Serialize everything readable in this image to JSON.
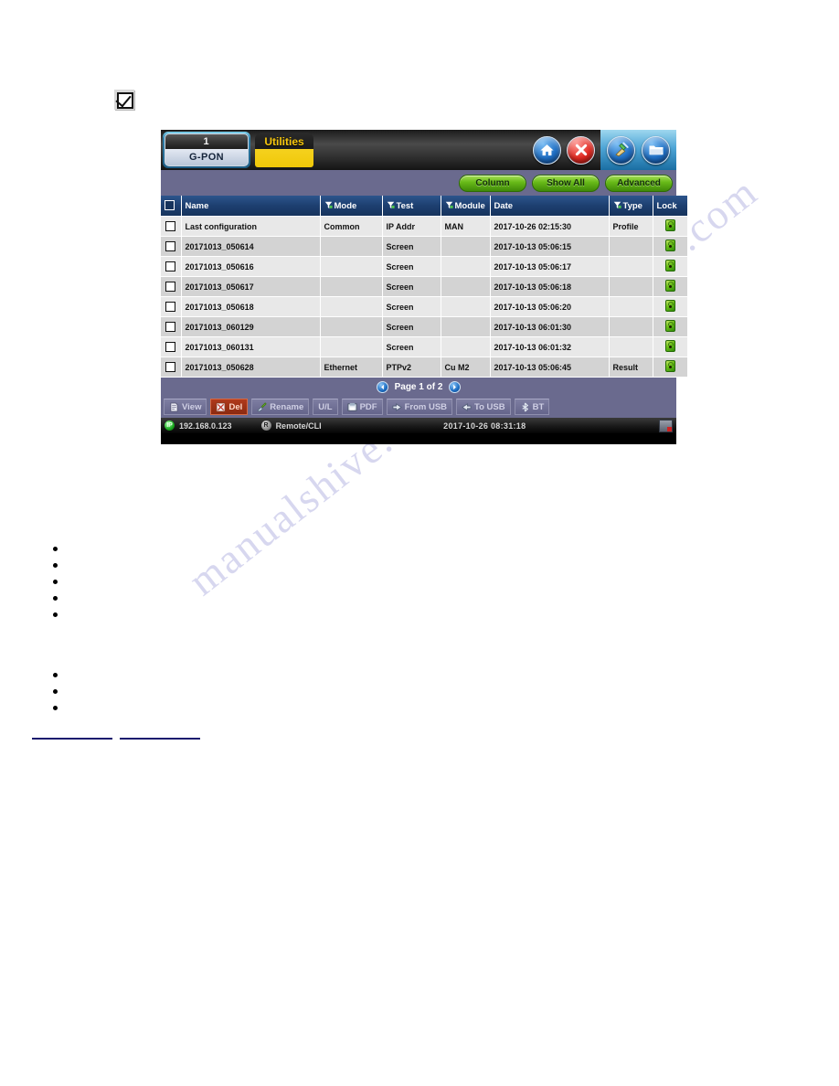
{
  "document": {
    "checkbox_icon": "checked-checkbox-icon",
    "bullets_group_1_count": 5,
    "bullets_group_2_count": 3,
    "watermark_text_1": "manualshive.com",
    "watermark_text_2": "manualshive.com"
  },
  "device": {
    "titlebar": {
      "port_tab": {
        "number": "1",
        "name": "G-PON"
      },
      "active_tab_label": "Utilities",
      "icons": [
        {
          "name": "home-icon",
          "label": "Home"
        },
        {
          "name": "close-icon",
          "label": "Close"
        },
        {
          "name": "tools-icon",
          "label": "Tools"
        },
        {
          "name": "folder-icon",
          "label": "File Browser"
        }
      ]
    },
    "actionbar": {
      "buttons": [
        {
          "label": "Column"
        },
        {
          "label": "Show All"
        },
        {
          "label": "Advanced"
        }
      ]
    },
    "table": {
      "columns": [
        {
          "key": "select",
          "label": "",
          "filter": false
        },
        {
          "key": "name",
          "label": "Name",
          "filter": false
        },
        {
          "key": "mode",
          "label": "Mode",
          "filter": true
        },
        {
          "key": "test",
          "label": "Test",
          "filter": true
        },
        {
          "key": "module",
          "label": "Module",
          "filter": true
        },
        {
          "key": "date",
          "label": "Date",
          "filter": false
        },
        {
          "key": "type",
          "label": "Type",
          "filter": true
        },
        {
          "key": "lock",
          "label": "Lock",
          "filter": false
        }
      ],
      "rows": [
        {
          "name": "Last configuration",
          "mode": "Common",
          "test": "IP Addr",
          "module": "MAN",
          "date": "2017-10-26 02:15:30",
          "type": "Profile",
          "locked": true,
          "checked": false
        },
        {
          "name": "20171013_050614",
          "mode": "",
          "test": "Screen",
          "module": "",
          "date": "2017-10-13 05:06:15",
          "type": "",
          "locked": true,
          "checked": false
        },
        {
          "name": "20171013_050616",
          "mode": "",
          "test": "Screen",
          "module": "",
          "date": "2017-10-13 05:06:17",
          "type": "",
          "locked": true,
          "checked": false
        },
        {
          "name": "20171013_050617",
          "mode": "",
          "test": "Screen",
          "module": "",
          "date": "2017-10-13 05:06:18",
          "type": "",
          "locked": true,
          "checked": false
        },
        {
          "name": "20171013_050618",
          "mode": "",
          "test": "Screen",
          "module": "",
          "date": "2017-10-13 05:06:20",
          "type": "",
          "locked": true,
          "checked": false
        },
        {
          "name": "20171013_060129",
          "mode": "",
          "test": "Screen",
          "module": "",
          "date": "2017-10-13 06:01:30",
          "type": "",
          "locked": true,
          "checked": false
        },
        {
          "name": "20171013_060131",
          "mode": "",
          "test": "Screen",
          "module": "",
          "date": "2017-10-13 06:01:32",
          "type": "",
          "locked": true,
          "checked": false
        },
        {
          "name": "20171013_050628",
          "mode": "Ethernet",
          "test": "PTPv2",
          "module": "Cu M2",
          "date": "2017-10-13 05:06:45",
          "type": "Result",
          "locked": true,
          "checked": false
        }
      ]
    },
    "pagination": {
      "prev_icon": "chevron-left-icon",
      "next_icon": "chevron-right-icon",
      "label": "Page 1 of 2"
    },
    "bottom_toolbar": {
      "buttons": [
        {
          "label": "View",
          "icon": "document-icon",
          "active": false
        },
        {
          "label": "Del",
          "icon": "delete-icon",
          "active": true
        },
        {
          "label": "Rename",
          "icon": "brush-icon",
          "active": false
        },
        {
          "label": "U/L",
          "icon": "",
          "active": false
        },
        {
          "label": "PDF",
          "icon": "pdf-icon",
          "active": false
        },
        {
          "label": "From USB",
          "icon": "arrow-in-icon",
          "active": false
        },
        {
          "label": "To USB",
          "icon": "arrow-out-icon",
          "active": false
        },
        {
          "label": "BT",
          "icon": "bluetooth-icon",
          "active": false
        }
      ]
    },
    "statusbar": {
      "ip_badge": "IP",
      "ip_address": "192.168.0.123",
      "remote_badge": "R",
      "remote_label": "Remote/CLI",
      "datetime": "2017-10-26  08:31:18",
      "right_icon": "screenshot-icon"
    }
  },
  "colors": {
    "accent_green": "#69bb19",
    "header_blue": "#1d3f70",
    "panel_purple": "#6a6a8e",
    "tab_yellow": "#f0c808",
    "danger_red": "#b03a1c"
  }
}
